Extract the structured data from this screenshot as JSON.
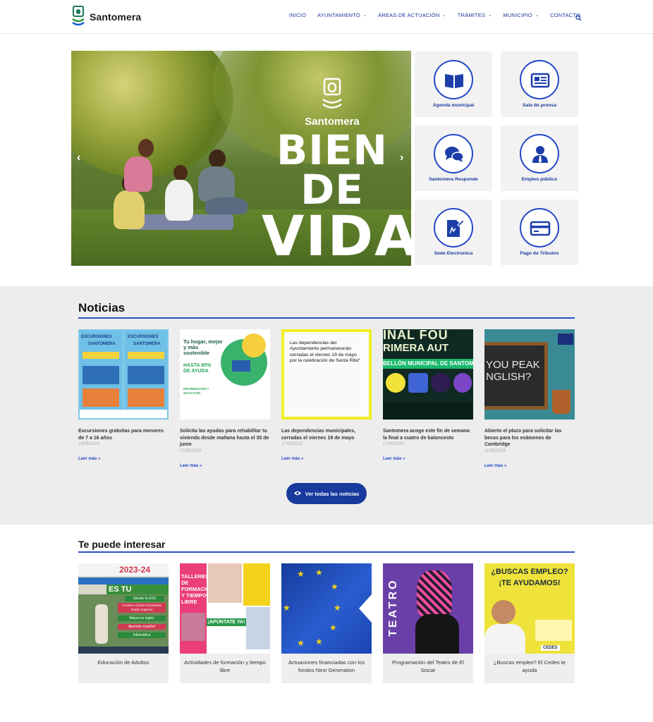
{
  "header": {
    "logo_text": "Santomera",
    "nav": [
      {
        "label": "INICIO",
        "has_dropdown": false
      },
      {
        "label": "AYUNTAMIENTO",
        "has_dropdown": true
      },
      {
        "label": "ÁREAS DE ACTUACIÓN",
        "has_dropdown": true
      },
      {
        "label": "TRÁMITES",
        "has_dropdown": true
      },
      {
        "label": "MUNICIPIO",
        "has_dropdown": true
      },
      {
        "label": "CONTACTO",
        "has_dropdown": false
      }
    ],
    "search_icon": "search-icon"
  },
  "hero": {
    "brand_name": "Santomera",
    "slogan_line1": "BIEN DE",
    "slogan_line2": "VIDA",
    "prev_icon": "chevron-left-icon",
    "next_icon": "chevron-right-icon"
  },
  "quick_links": [
    {
      "label": "Agenda municipal",
      "icon": "book-icon"
    },
    {
      "label": "Sala de prensa",
      "icon": "newspaper-icon"
    },
    {
      "label": "Santomera Responde",
      "icon": "chat-bubbles-icon"
    },
    {
      "label": "Empleo público",
      "icon": "person-icon"
    },
    {
      "label": "Sede Electronica",
      "icon": "document-pen-icon"
    },
    {
      "label": "Pago de Tributos",
      "icon": "credit-card-icon"
    }
  ],
  "news": {
    "title": "Noticias",
    "items": [
      {
        "title": "Excursiones gratuitas para menores de 7 a 16 años",
        "date": "18/05/2023",
        "more": "Leer más »"
      },
      {
        "title": "Solicita las ayudas para rehabilitar tu vivienda desde mañana hasta el 30 de junio",
        "date": "17/05/2023",
        "more": "Leer más »"
      },
      {
        "title": "Las dependencias municipales, cerradas el viernes 19 de mayo",
        "date": "17/05/2023",
        "more": "Leer más »"
      },
      {
        "title": "Santomera acoge este fin de semana la final a cuatro de baloncesto",
        "date": "17/05/2023",
        "more": "Leer más »"
      },
      {
        "title": "Abierto el plazo para solicitar las becas para los exámenes de Cambridge",
        "date": "11/05/2023",
        "more": "Leer más »"
      }
    ],
    "images": {
      "excursiones_label": "EXCURSIONES",
      "santomera": "SANTOMERA",
      "vivienda_head": "Tu hogar, mejor y más sostenible",
      "vivienda_pct": "HASTA 80% DE AYUDA",
      "vivienda_info": "INFORMACIÓN Y SOLICITUD",
      "dependencias_text": "Las dependencias del Ayuntamiento permanecerán cerradas el viernes 19 de mayo por la celebración de Santa Rita*",
      "baloncesto_top": "INAL FOU",
      "baloncesto_mid": "RIMERA AUT",
      "baloncesto_pab": "BELLÓN MUNICIPAL DE SANTOME",
      "english_text": "YOU PEAK NGLISH?"
    },
    "button_label": "Ver todas las noticias",
    "button_icon": "eye-icon"
  },
  "interest": {
    "title": "Te puede interesar",
    "items": [
      {
        "label": "Educación de Adultos"
      },
      {
        "label": "Actividades de formación y tiempo libre"
      },
      {
        "label": "Actuaciones financiadas con los fondos Next Generation"
      },
      {
        "label": "Programación del Teatro de El Siscar"
      },
      {
        "label": "¿Buscas empleo? El Cedes te ayuda"
      }
    ],
    "images": {
      "adultos_year": "2023-24",
      "adultos_main": "ES TU MOMENTO",
      "adultos_items": [
        "Sácate la ESO",
        "Acceso a Ciclos Formativos Grado Superior",
        "Mejora tu inglés",
        "Aprende español",
        "Informática"
      ],
      "actividades_main": "TALLERES DE FORMACIÓN Y TIEMPO LIBRE",
      "actividades_cta": "¡APÚNTATE YA!",
      "teatro_word": "TEATRO",
      "empleo_q": "¿BUSCAS EMPLEO?",
      "empleo_a": "¡TE AYUDAMOS!",
      "empleo_brand": "CEDES"
    }
  }
}
